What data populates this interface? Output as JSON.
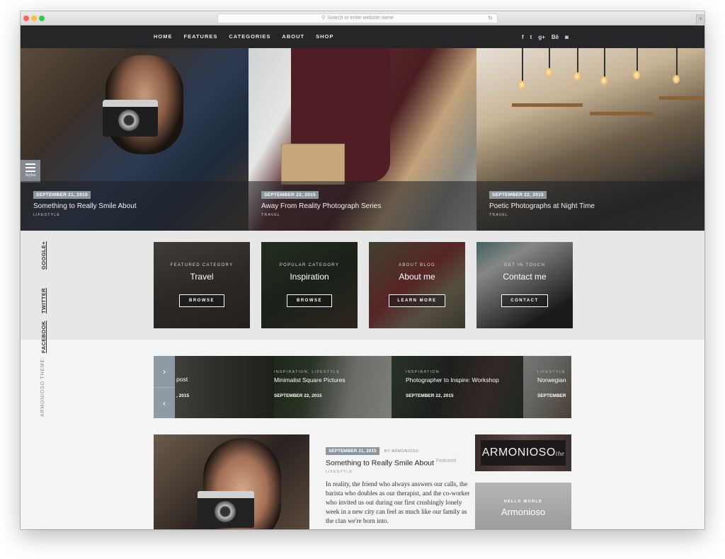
{
  "browser": {
    "url_placeholder": "Search or enter website name",
    "search_icon": "magnifier-icon",
    "reload_icon": "reload-icon",
    "new_tab_icon": "plus-icon"
  },
  "nav": {
    "items": [
      "HOME",
      "FEATURES",
      "CATEGORIES",
      "ABOUT",
      "SHOP"
    ],
    "social": [
      {
        "name": "facebook-icon",
        "glyph": "f"
      },
      {
        "name": "twitter-icon",
        "glyph": "t"
      },
      {
        "name": "google-plus-icon",
        "glyph": "g+"
      },
      {
        "name": "behance-icon",
        "glyph": "Bē"
      },
      {
        "name": "instagram-icon",
        "glyph": "◙"
      }
    ]
  },
  "hero": {
    "styles_label": "Styles",
    "slides": [
      {
        "date": "SEPTEMBER 21, 2015",
        "title": "Something to Really Smile About",
        "category": "LIFESTYLE"
      },
      {
        "date": "SEPTEMBER 22, 2015",
        "title": "Away From Reality Photograph Series",
        "category": "TRAVEL"
      },
      {
        "date": "SEPTEMBER 22, 2015",
        "title": "Poetic Photographs at Night Time",
        "category": "TRAVEL"
      }
    ]
  },
  "side_social": {
    "links": [
      "GOOGLE+",
      "TWITTER",
      "FACEBOOK"
    ],
    "theme_label": "ARMONIOSO THEME:"
  },
  "promo_cards": [
    {
      "subtitle": "FEATURED CATEGORY",
      "title": "Travel",
      "button": "BROWSE"
    },
    {
      "subtitle": "POPULAR CATEGORY",
      "title": "Inspiration",
      "button": "BROWSE"
    },
    {
      "subtitle": "ABOUT BLOG",
      "title": "About me",
      "button": "LEARN MORE"
    },
    {
      "subtitle": "GET IN TOUCH",
      "title": "Contact me",
      "button": "CONTACT"
    }
  ],
  "carousel": {
    "next_icon": "›",
    "prev_icon": "‹",
    "items": [
      {
        "category": "",
        "title": "post",
        "date": ", 2015"
      },
      {
        "category": "INSPIRATION, LIFESTYLE",
        "title": "Minimalist Square Pictures",
        "date": "SEPTEMBER 22, 2015"
      },
      {
        "category": "INSPIRATION",
        "title": "Photographer to Inspire: Workshop",
        "date": "SEPTEMBER 22, 2015"
      },
      {
        "category": "LIFESTYLE",
        "title": "Norwegian",
        "date": "SEPTEMBER"
      }
    ]
  },
  "featured_post": {
    "date": "SEPTEMBER 21, 2015",
    "author": "BY ARMONIOSO",
    "title": "Something to Really Smile About",
    "badge": "Featured",
    "category": "LIFESTYLE",
    "excerpt": "In reality, the friend who always answers our calls, the barista who doubles as our therapist, and the co-worker who invited us out during our first crushingly lonely week in a new city can feel as much like our family as the clan we're born into."
  },
  "widgets": {
    "logo_text": "ARMONIOSO",
    "logo_script": "the",
    "hello_label": "HELLO WORLD",
    "hello_title": "Armonioso"
  }
}
